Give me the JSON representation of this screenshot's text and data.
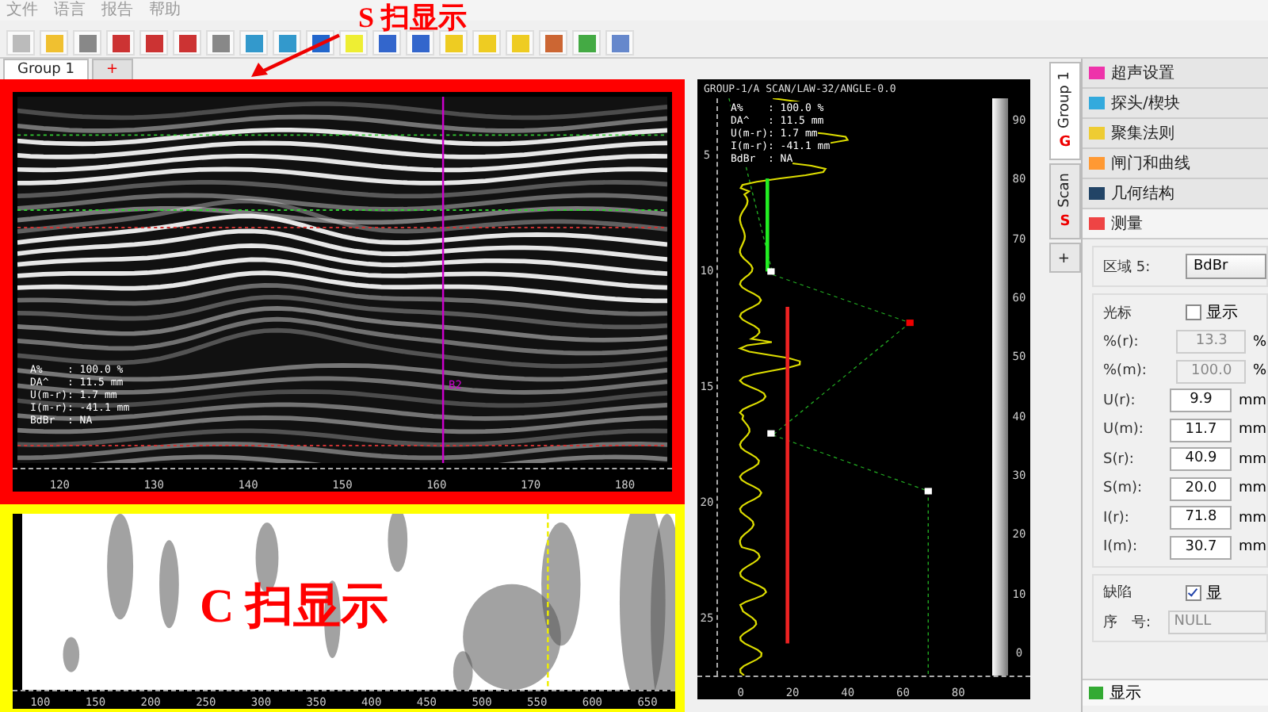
{
  "menu": [
    {
      "label": "文件"
    },
    {
      "label": "语言"
    },
    {
      "label": "报告"
    },
    {
      "label": "帮助"
    }
  ],
  "group_tabs": [
    {
      "label": "Group 1",
      "selected": true
    },
    {
      "label": "+",
      "selected": false
    }
  ],
  "s_scan": {
    "annotation": "S 扫显示",
    "cursor_label": "B2",
    "readouts": [
      "A%    : 100.0 %",
      "DA^   : 11.5 mm",
      "U(m-r): 1.7 mm",
      "I(m-r): -41.1 mm",
      "BdBr  : NA"
    ],
    "x_ticks": [
      "120",
      "130",
      "140",
      "150",
      "160",
      "170",
      "180"
    ]
  },
  "c_scan": {
    "annotation": "C 扫显示",
    "x_ticks": [
      "100",
      "150",
      "200",
      "250",
      "300",
      "350",
      "400",
      "450",
      "500",
      "550",
      "600",
      "650"
    ]
  },
  "a_scan": {
    "title": "GROUP-1/A SCAN/LAW-32/ANGLE-0.0",
    "readouts": [
      "A%    : 100.0 %",
      "DA^   : 11.5 mm",
      "U(m-r): 1.7 mm",
      "I(m-r): -41.1 mm",
      "BdBr  : NA"
    ],
    "depth_ticks": [
      "5",
      "10",
      "15",
      "20",
      "25"
    ],
    "amplitude_ticks": [
      "0",
      "20",
      "40",
      "60",
      "80"
    ],
    "scale_ticks": [
      "90",
      "80",
      "70",
      "60",
      "50",
      "40",
      "30",
      "20",
      "10",
      "0"
    ]
  },
  "side_tabs": [
    {
      "label": "Group 1",
      "icon": "G",
      "selected": true
    },
    {
      "label": "Scan",
      "icon": "S",
      "selected": false
    },
    {
      "label": "+",
      "selected": false
    }
  ],
  "sections": [
    {
      "label": "超声设置",
      "expanded": false
    },
    {
      "label": "探头/楔块",
      "expanded": false
    },
    {
      "label": "聚集法则",
      "expanded": false
    },
    {
      "label": "闸门和曲线",
      "expanded": false
    },
    {
      "label": "几何结构",
      "expanded": false
    },
    {
      "label": "测量",
      "expanded": true
    }
  ],
  "measure": {
    "zone_label": "区域 5:",
    "zone_value": "BdBr",
    "cursor": {
      "label": "光标",
      "checkbox_label": "显示",
      "checked": false
    },
    "fields": [
      {
        "label": "%(r):",
        "value": "13.3",
        "unit": "%",
        "disabled": true
      },
      {
        "label": "%(m):",
        "value": "100.0",
        "unit": "%",
        "disabled": true
      },
      {
        "label": "U(r):",
        "value": "9.9",
        "unit": "mm",
        "disabled": false
      },
      {
        "label": "U(m):",
        "value": "11.7",
        "unit": "mm",
        "disabled": false
      },
      {
        "label": "S(r):",
        "value": "40.9",
        "unit": "mm",
        "disabled": false
      },
      {
        "label": "S(m):",
        "value": "20.0",
        "unit": "mm",
        "disabled": false
      },
      {
        "label": "I(r):",
        "value": "71.8",
        "unit": "mm",
        "disabled": false
      },
      {
        "label": "I(m):",
        "value": "30.7",
        "unit": "mm",
        "disabled": false
      }
    ],
    "defect": {
      "label": "缺陷",
      "checkbox_label": "显",
      "checked": true
    },
    "serial": {
      "label": "序　号:",
      "value": "NULL",
      "disabled": true
    }
  },
  "footer": {
    "label": "显示"
  }
}
